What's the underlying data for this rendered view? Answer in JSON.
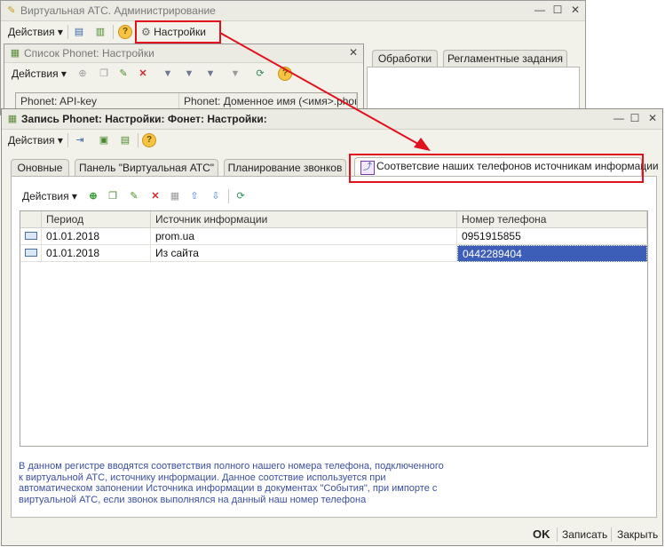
{
  "main_window": {
    "title": "Виртуальная АТС. Администрирование",
    "actions_label": "Действия",
    "settings_label": "Настройки",
    "tabs": [
      "Обработки",
      "Регламентные задания"
    ]
  },
  "list_window": {
    "title": "Список Phonet: Настройки",
    "actions_label": "Действия",
    "columns": [
      "Phonet: API-key",
      "Phonet: Доменное имя (<имя>.phon"
    ]
  },
  "record_window": {
    "title": "Запись Phonet: Настройки: Фонет: Настройки:",
    "actions_label": "Действия",
    "tabs": [
      "Оновные",
      "Панель \"Виртуальная АТС\"",
      "Планирование звонков",
      "Соответсвие наших телефонов источникам информации"
    ],
    "inner_actions_label": "Действия",
    "table": {
      "columns": [
        "Период",
        "Источник информации",
        "Номер телефона"
      ],
      "rows": [
        {
          "period": "01.01.2018",
          "source": "prom.ua",
          "phone": "0951915855"
        },
        {
          "period": "01.01.2018",
          "source": "Из сайта",
          "phone": "0442289404"
        }
      ]
    },
    "note_lines": [
      "В данном регистре вводятся соответствия полного нашего номера телефона, подключенного",
      "к виртуальной АТС, источнику информации. Данное соотствие используется при",
      "автоматическом запонении Источника информации в документах \"События\", при импорте с",
      "виртуальной АТС, если звонок выполнялся на данный наш номер телефона"
    ],
    "buttons": {
      "ok": "OK",
      "save": "Записать",
      "close": "Закрыть"
    }
  },
  "colors": {
    "highlight": "#e0111d",
    "selection": "#3d5eb8",
    "note_text": "#3b4fa0"
  }
}
